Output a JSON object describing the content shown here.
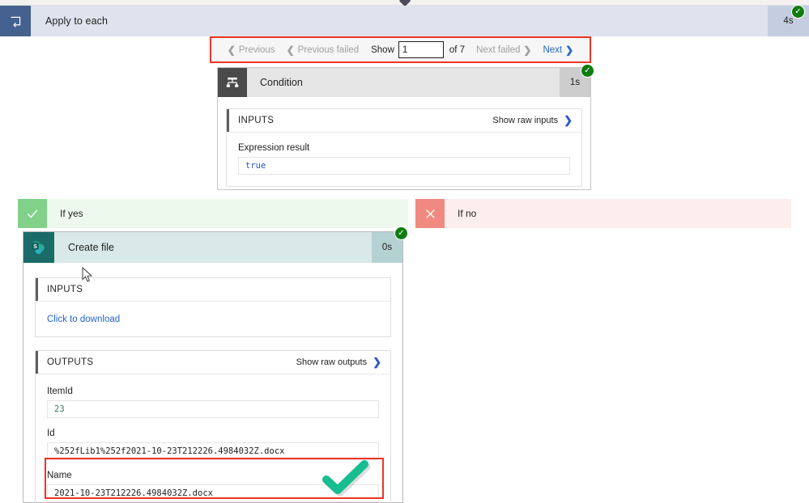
{
  "scope": {
    "title": "Apply to each",
    "duration": "4s",
    "icon": "apply-to-each-loop-icon",
    "status": "succeeded",
    "header_bg": "#dfe3ee",
    "icon_bg": "#44618f"
  },
  "pager": {
    "previous": "Previous",
    "previous_failed": "Previous failed",
    "show_label": "Show",
    "current_page": "1",
    "of_label": "of 7",
    "next_failed": "Next failed",
    "next": "Next",
    "highlight_color": "#ee3524"
  },
  "condition": {
    "title": "Condition",
    "duration": "1s",
    "status": "succeeded",
    "icon": "condition-branch-icon",
    "inputs": {
      "heading": "INPUTS",
      "raw_link": "Show raw inputs",
      "field_label": "Expression result",
      "field_value": "true"
    }
  },
  "branches": {
    "yes": {
      "label": "If yes",
      "icon": "check-icon",
      "bg": "#eef9ee",
      "icon_bg": "#82d18b"
    },
    "no": {
      "label": "If no",
      "icon": "close-icon",
      "bg": "#fdeeee",
      "icon_bg": "#f08a80"
    }
  },
  "create_file": {
    "title": "Create file",
    "duration": "0s",
    "status": "succeeded",
    "icon": "sharepoint-icon",
    "inputs": {
      "heading": "INPUTS",
      "download_link": "Click to download"
    },
    "outputs": {
      "heading": "OUTPUTS",
      "raw_link": "Show raw outputs",
      "fields": [
        {
          "label": "ItemId",
          "value": "23",
          "value_kind": "number"
        },
        {
          "label": "Id",
          "value": "%252fLib1%252f2021-10-23T212226.4984032Z.docx",
          "value_kind": "text"
        },
        {
          "label": "Name",
          "value": "2021-10-23T212226.4984032Z.docx",
          "value_kind": "text",
          "highlighted": true
        }
      ]
    }
  },
  "annotations": {
    "name_highlight_color": "#ee3524",
    "check_mark_color": "#16bd8e"
  }
}
